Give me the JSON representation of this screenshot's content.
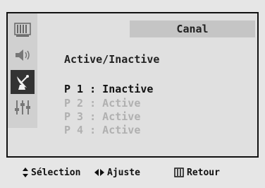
{
  "header": {
    "title": "Canal"
  },
  "subtitle": "Active/Inactive",
  "programs": [
    {
      "text": "P 1 : Inactive",
      "selected": true
    },
    {
      "text": "P 2 : Active",
      "selected": false
    },
    {
      "text": "P 3 : Active",
      "selected": false
    },
    {
      "text": "P 4 : Active",
      "selected": false
    }
  ],
  "sidebar": {
    "items": [
      {
        "icon": "picture-menu-icon",
        "active": false
      },
      {
        "icon": "sound-speaker-icon",
        "active": false
      },
      {
        "icon": "channel-antenna-icon",
        "active": true
      },
      {
        "icon": "setup-sliders-icon",
        "active": false
      }
    ]
  },
  "footer": {
    "select_label": "Sélection",
    "adjust_label": "Ajuste",
    "return_label": "Retour"
  },
  "colors": {
    "selected_text": "#111111",
    "dim_text": "#b0b0b0",
    "active_icon_bg": "#333333"
  }
}
